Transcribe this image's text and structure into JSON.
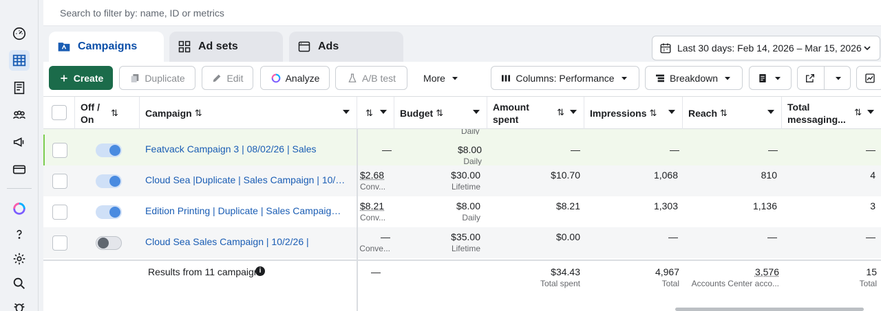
{
  "filter": {
    "placeholder": "Search to filter by: name, ID or metrics"
  },
  "tabs": [
    {
      "label": "Campaigns",
      "icon": "campaigns-folder-icon"
    },
    {
      "label": "Ad sets",
      "icon": "ad-sets-grid-icon"
    },
    {
      "label": "Ads",
      "icon": "ads-window-icon"
    }
  ],
  "date_range": {
    "label": "Last 30 days: Feb 14, 2026 – Mar 15, 2026"
  },
  "toolbar": {
    "create": "Create",
    "duplicate": "Duplicate",
    "edit": "Edit",
    "analyze": "Analyze",
    "ab_test": "A/B test",
    "more": "More",
    "columns": "Columns: Performance",
    "breakdown": "Breakdown"
  },
  "table": {
    "headers": {
      "off_on": "Off / On",
      "campaign": "Campaign",
      "budget": "Budget",
      "amount_spent": "Amount spent",
      "impressions": "Impressions",
      "reach": "Reach",
      "total_messaging": "Total messaging..."
    },
    "partial_row_sub": "Daily",
    "rows": [
      {
        "name": "Featvack Campaign 3 | 08/02/26 | Sales",
        "results": "—",
        "results_sub": "",
        "budget": "$8.00",
        "budget_type": "Daily",
        "amount_spent": "—",
        "impressions": "—",
        "reach": "—",
        "messaging": "—",
        "on": true
      },
      {
        "name": "Cloud Sea |Duplicate | Sales Campaign | 10/2...",
        "results": "$2.68",
        "results_sub": "Conv...",
        "budget": "$30.00",
        "budget_type": "Lifetime",
        "amount_spent": "$10.70",
        "impressions": "1,068",
        "reach": "810",
        "messaging": "4",
        "on": true
      },
      {
        "name": "Edition Printing | Duplicate | Sales Campaign ...",
        "results": "$8.21",
        "results_sub": "Conv...",
        "budget": "$8.00",
        "budget_type": "Daily",
        "amount_spent": "$8.21",
        "impressions": "1,303",
        "reach": "1,136",
        "messaging": "3",
        "on": true
      },
      {
        "name": "Cloud Sea Sales Campaign | 10/2/26 |",
        "results": "—",
        "results_sub": "Conve...",
        "budget": "$35.00",
        "budget_type": "Lifetime",
        "amount_spent": "$0.00",
        "impressions": "—",
        "reach": "—",
        "messaging": "—",
        "on": false
      }
    ],
    "footer": {
      "label": "Results from 11 campaigns",
      "results": "—",
      "amount_spent": "$34.43",
      "amount_spent_sub": "Total spent",
      "impressions": "4,967",
      "impressions_sub": "Total",
      "reach": "3,576",
      "reach_sub": "Accounts Center acco...",
      "messaging": "15",
      "messaging_sub": "Total"
    }
  },
  "colors": {
    "create_button": "#1b6b4a",
    "link": "#1a5db4",
    "active_tab": "#0a4ea8",
    "highlight_row": "#f1f8ec"
  }
}
